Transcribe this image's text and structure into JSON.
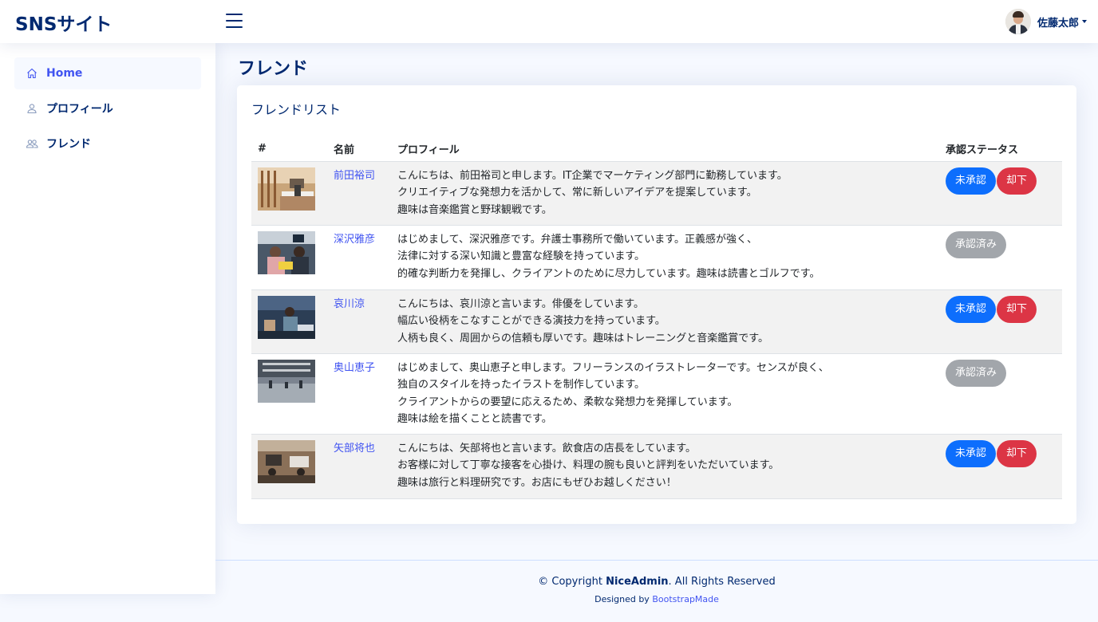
{
  "header": {
    "logo": "SNSサイト",
    "user_name": "佐藤太郎"
  },
  "sidebar": {
    "items": [
      {
        "label": "Home",
        "icon": "house-icon",
        "active": true
      },
      {
        "label": "プロフィール",
        "icon": "person-icon",
        "active": false
      },
      {
        "label": "フレンド",
        "icon": "people-icon",
        "active": false
      }
    ]
  },
  "main": {
    "page_title": "フレンド",
    "card_title": "フレンドリスト",
    "table": {
      "headers": [
        "#",
        "名前",
        "プロフィール",
        "承認ステータス"
      ],
      "rows": [
        {
          "name": "前田裕司",
          "profile_lines": [
            "こんにちは、前田裕司と申します。IT企業でマーケティング部門に勤務しています。",
            "クリエイティブな発想力を活かして、常に新しいアイデアを提案しています。",
            "趣味は音楽鑑賞と野球観戦です。"
          ],
          "status": "pending",
          "buttons": [
            "未承認",
            "却下"
          ]
        },
        {
          "name": "深沢雅彦",
          "profile_lines": [
            "はじめまして、深沢雅彦です。弁護士事務所で働いています。正義感が強く、",
            "法律に対する深い知識と豊富な経験を持っています。",
            "的確な判断力を発揮し、クライアントのために尽力しています。趣味は読書とゴルフです。"
          ],
          "status": "approved",
          "buttons": [
            "承認済み"
          ]
        },
        {
          "name": "哀川涼",
          "profile_lines": [
            "こんにちは、哀川涼と言います。俳優をしています。",
            "幅広い役柄をこなすことができる演技力を持っています。",
            "人柄も良く、周囲からの信頼も厚いです。趣味はトレーニングと音楽鑑賞です。"
          ],
          "status": "pending",
          "buttons": [
            "未承認",
            "却下"
          ]
        },
        {
          "name": "奥山恵子",
          "profile_lines": [
            "はじめまして、奥山恵子と申します。フリーランスのイラストレーターです。センスが良く、",
            "独自のスタイルを持ったイラストを制作しています。",
            "クライアントからの要望に応えるため、柔軟な発想力を発揮しています。",
            "趣味は絵を描くことと読書です。"
          ],
          "status": "approved",
          "buttons": [
            "承認済み"
          ]
        },
        {
          "name": "矢部将也",
          "profile_lines": [
            "こんにちは、矢部将也と言います。飲食店の店長をしています。",
            "お客様に対して丁寧な接客を心掛け、料理の腕も良いと評判をいただいています。",
            "趣味は旅行と料理研究です。お店にもぜひお越しください！"
          ],
          "status": "pending",
          "buttons": [
            "未承認",
            "却下"
          ]
        }
      ]
    }
  },
  "footer": {
    "copyright_prefix": "© Copyright ",
    "brand": "NiceAdmin",
    "copyright_suffix": ". All Rights Reserved",
    "designed_by": "Designed by ",
    "designer": "BootstrapMade"
  },
  "colors": {
    "primary_text": "#012970",
    "link": "#4154f1",
    "pending": "#0d6efd",
    "reject": "#dc3545",
    "approved": "#a2a6ab"
  }
}
